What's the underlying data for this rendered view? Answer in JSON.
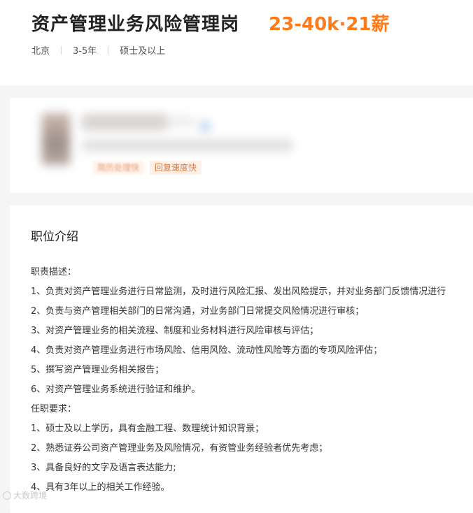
{
  "job": {
    "title": "资产管理业务风险管理岗",
    "salary": "23-40k·21薪",
    "meta": [
      "北京",
      "3-5年",
      "硕士及以上"
    ]
  },
  "recruiter": {
    "tags": [
      "简历处理快",
      "回复速度快"
    ]
  },
  "description": {
    "section_title": "职位介绍",
    "lines": [
      "职责描述：",
      "1、负责对资产管理业务进行日常监测，及时进行风险汇报、发出风险提示，并对业务部门反馈情况进行",
      "2、负责与资产管理相关部门的日常沟通，对业务部门日常提交风险情况进行审核；",
      "3、对资产管理业务的相关流程、制度和业务材料进行风险审核与评估；",
      "4、负责对资产管理业务进行市场风险、信用风险、流动性风险等方面的专项风险评估；",
      "5、撰写资产管理业务相关报告；",
      "6、对资产管理业务系统进行验证和维护。",
      "任职要求：",
      "1、硕士及以上学历，具有金融工程、数理统计知识背景；",
      "2、熟悉证券公司资产管理业务及风险情况，有资管业务经验者优先考虑；",
      "3、具备良好的文字及语言表达能力;",
      "4、具有3年以上的相关工作经验。"
    ]
  },
  "watermark": {
    "text": "大数跨境"
  },
  "colors": {
    "salary": "#ff7a1a",
    "tag_text": "#e07a3c",
    "tag_bg": "#fff1e8"
  }
}
